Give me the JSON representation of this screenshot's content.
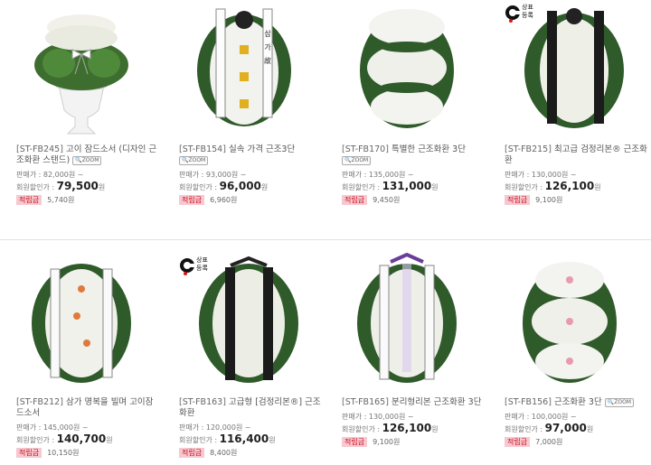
{
  "zoom_label": "ZOOM",
  "point_label": "적립금",
  "price_label": "판매가 :",
  "member_label": "회원할인가 :",
  "brand_mark": {
    "line1": "상표",
    "line2": "등록"
  },
  "products": [
    {
      "code": "[ST-FB245]",
      "name": "고이 잠드소서 (디자인 근조화환 스탠드)",
      "price": "82,000원 ~",
      "sale": "79,500",
      "won": "원",
      "point": "5,740원"
    },
    {
      "code": "[ST-FB154]",
      "name": "실속 가격 근조3단",
      "price": "93,000원 ~",
      "sale": "96,000",
      "won": "원",
      "point": "6,960원"
    },
    {
      "code": "[ST-FB170]",
      "name": "특별한 근조화환 3단",
      "price": "135,000원 ~",
      "sale": "131,000",
      "won": "원",
      "point": "9,450원"
    },
    {
      "code": "[ST-FB215]",
      "name": "최고급 검정리본® 근조화환",
      "price": "130,000원 ~",
      "sale": "126,100",
      "won": "원",
      "point": "9,100원"
    },
    {
      "code": "[ST-FB212]",
      "name": "삼가 명복을 빌며 고이잠드소서",
      "price": "145,000원 ~",
      "sale": "140,700",
      "won": "원",
      "point": "10,150원"
    },
    {
      "code": "[ST-FB163]",
      "name": "고급형 [검정리본®] 근조화환",
      "price": "120,000원 ~",
      "sale": "116,400",
      "won": "원",
      "point": "8,400원"
    },
    {
      "code": "[ST-FB165]",
      "name": "분리형리본 근조화환 3단",
      "price": "130,000원 ~",
      "sale": "126,100",
      "won": "원",
      "point": "9,100원"
    },
    {
      "code": "[ST-FB156]",
      "name": "근조화환 3단",
      "price": "100,000원 ~",
      "sale": "97,000",
      "won": "원",
      "point": "7,000원"
    }
  ],
  "colors": {
    "point_bg": "#f6c8cf",
    "point_text": "#cc1122",
    "leaf": "#2f5a2a",
    "flower": "#f4f4f0"
  }
}
